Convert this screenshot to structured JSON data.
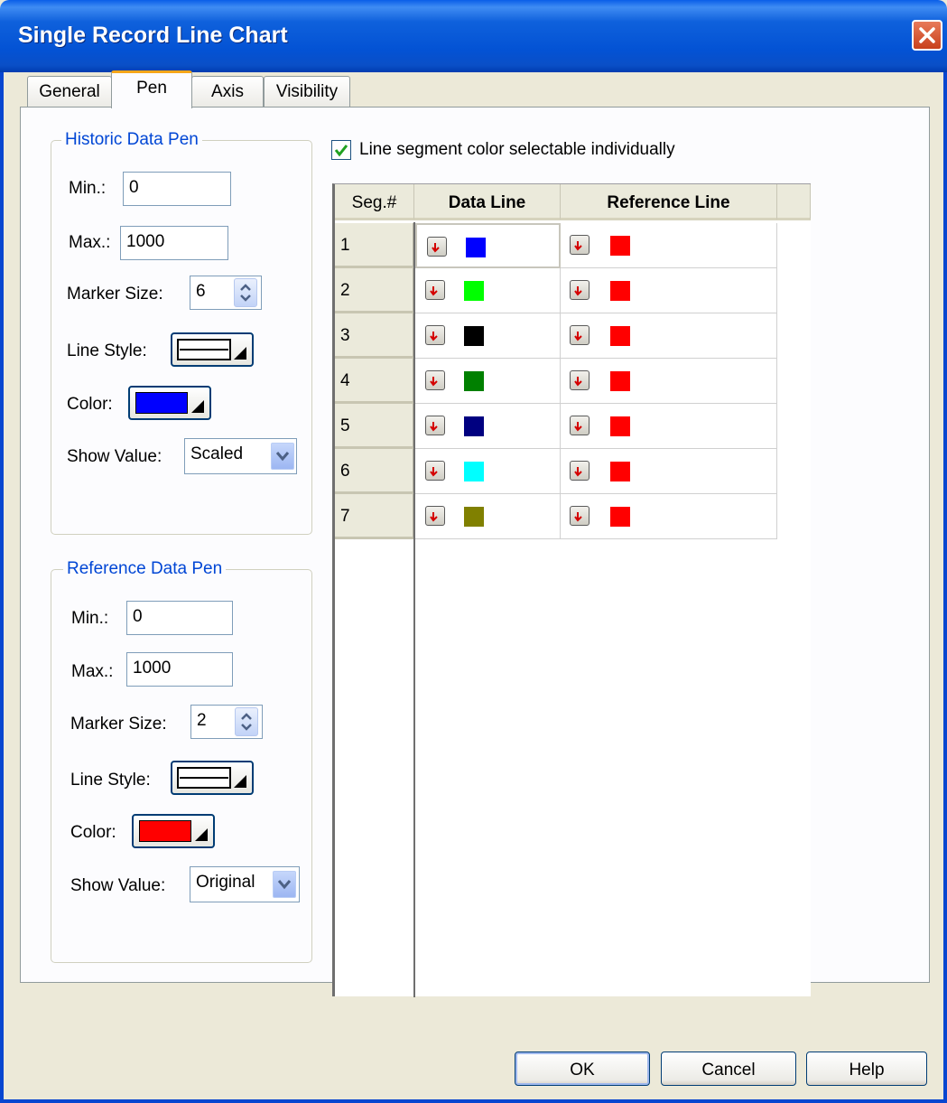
{
  "window": {
    "title": "Single Record Line Chart"
  },
  "tabs": [
    {
      "label": "General"
    },
    {
      "label": "Pen"
    },
    {
      "label": "Axis"
    },
    {
      "label": "Visibility"
    }
  ],
  "active_tab": "Pen",
  "historic_pen": {
    "legend": "Historic Data Pen",
    "min_label": "Min.:",
    "min_value": "0",
    "max_label": "Max.:",
    "max_value": "1000",
    "marker_size_label": "Marker Size:",
    "marker_size_value": "6",
    "line_style_label": "Line Style:",
    "color_label": "Color:",
    "color": "#0000ff",
    "show_value_label": "Show Value:",
    "show_value": "Scaled"
  },
  "reference_pen": {
    "legend": "Reference Data Pen",
    "min_label": "Min.:",
    "min_value": "0",
    "max_label": "Max.:",
    "max_value": "1000",
    "marker_size_label": "Marker Size:",
    "marker_size_value": "2",
    "line_style_label": "Line Style:",
    "color_label": "Color:",
    "color": "#ff0000",
    "show_value_label": "Show Value:",
    "show_value": "Original"
  },
  "segment_checkbox": {
    "label": "Line segment color selectable individually",
    "checked": true
  },
  "grid": {
    "headers": {
      "seg": "Seg.#",
      "data": "Data Line",
      "reference": "Reference Line"
    },
    "rows": [
      {
        "seg": "1",
        "data_color": "#0000ff",
        "ref_color": "#ff0000"
      },
      {
        "seg": "2",
        "data_color": "#00ff00",
        "ref_color": "#ff0000"
      },
      {
        "seg": "3",
        "data_color": "#000000",
        "ref_color": "#ff0000"
      },
      {
        "seg": "4",
        "data_color": "#008000",
        "ref_color": "#ff0000"
      },
      {
        "seg": "5",
        "data_color": "#000080",
        "ref_color": "#ff0000"
      },
      {
        "seg": "6",
        "data_color": "#00ffff",
        "ref_color": "#ff0000"
      },
      {
        "seg": "7",
        "data_color": "#808000",
        "ref_color": "#ff0000"
      }
    ]
  },
  "buttons": {
    "ok": "OK",
    "cancel": "Cancel",
    "help": "Help"
  },
  "icons": {
    "close": "close-icon",
    "dropdown": "dropdown-arrow-icon",
    "color_picker": "color-picker-icon"
  }
}
